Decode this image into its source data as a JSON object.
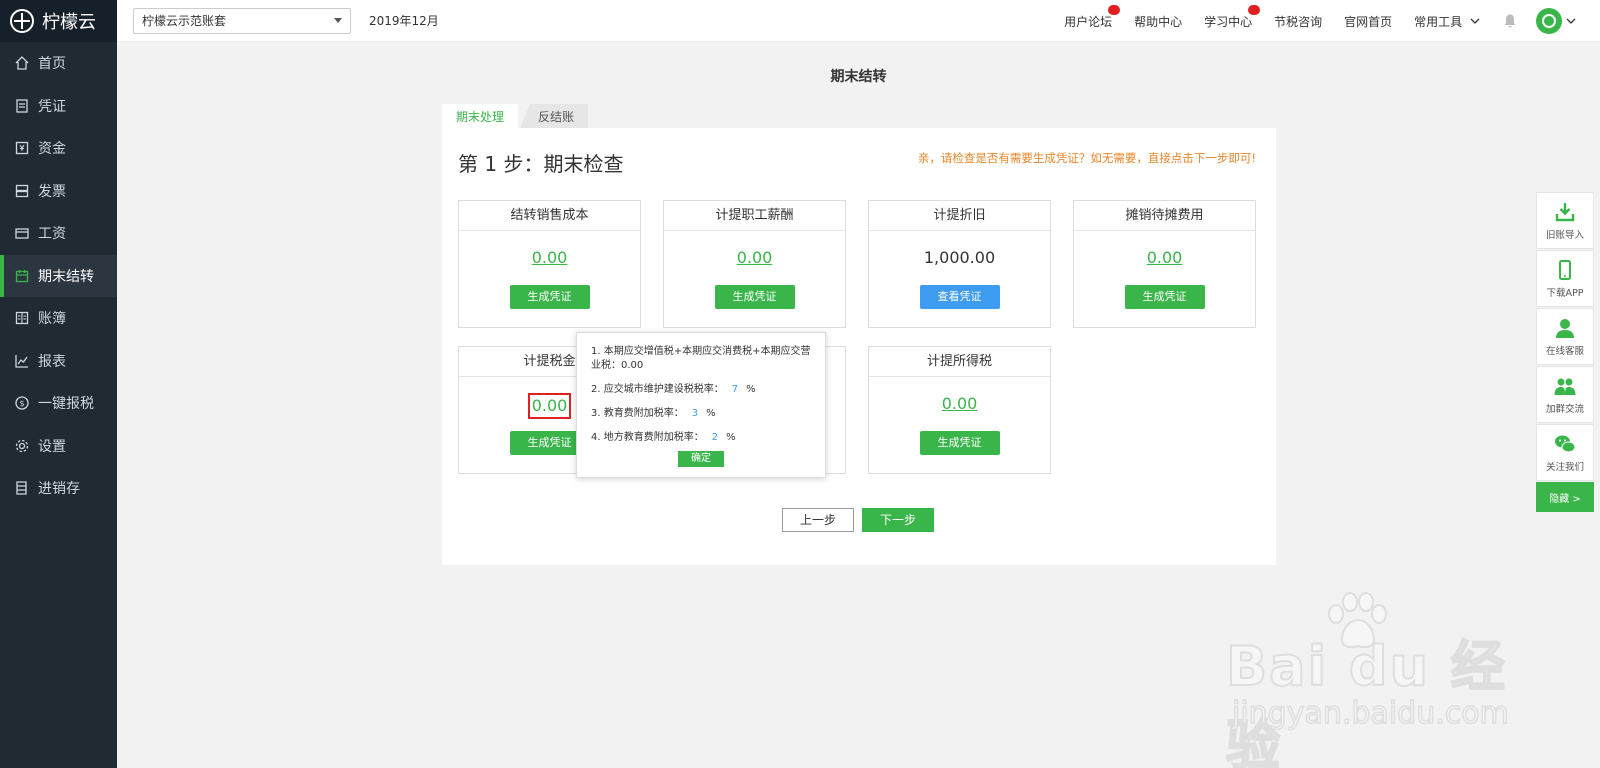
{
  "app": {
    "name": "柠檬云"
  },
  "sidebar": {
    "items": [
      {
        "label": "首页",
        "icon": "home-icon"
      },
      {
        "label": "凭证",
        "icon": "voucher-icon"
      },
      {
        "label": "资金",
        "icon": "fund-icon"
      },
      {
        "label": "发票",
        "icon": "invoice-icon"
      },
      {
        "label": "工资",
        "icon": "salary-icon"
      },
      {
        "label": "期末结转",
        "icon": "calendar-icon",
        "active": true
      },
      {
        "label": "账簿",
        "icon": "ledger-icon"
      },
      {
        "label": "报表",
        "icon": "chart-icon"
      },
      {
        "label": "一键报税",
        "icon": "tax-icon"
      },
      {
        "label": "设置",
        "icon": "gear-icon"
      },
      {
        "label": "进销存",
        "icon": "inventory-icon"
      }
    ]
  },
  "topbar": {
    "account_set": "柠檬云示范账套",
    "period": "2019年12月",
    "links": [
      "用户论坛",
      "帮助中心",
      "学习中心",
      "节税咨询",
      "官网首页",
      "常用工具"
    ]
  },
  "main": {
    "title": "期末结转",
    "tabs": [
      "期末处理",
      "反结账"
    ],
    "step_title": "第 1 步：期末检查",
    "hint": "亲，请检查是否有需要生成凭证？如无需要，直接点击下一步即可!",
    "cards": [
      {
        "title": "结转销售成本",
        "value": "0.00",
        "button": "生成凭证"
      },
      {
        "title": "计提职工薪酬",
        "value": "0.00",
        "button": "生成凭证"
      },
      {
        "title": "计提折旧",
        "value": "1,000.00",
        "button": "查看凭证"
      },
      {
        "title": "摊销待摊费用",
        "value": "0.00",
        "button": "生成凭证"
      },
      {
        "title": "计提税金",
        "value": "0.00",
        "button": "生成凭证"
      },
      {
        "title": "计提所得税",
        "value": "0.00",
        "button": "生成凭证"
      }
    ],
    "prev_label": "上一步",
    "next_label": "下一步"
  },
  "popup": {
    "line1": "1. 本期应交增值税+本期应交消费税+本期应交营业税：0.00",
    "line2_label": "2. 应交城市维护建设税税率：",
    "line2_value": "7",
    "line3_label": "3. 教育费附加税率：",
    "line3_value": "3",
    "line4_label": "4. 地方教育费附加税率：",
    "line4_value": "2",
    "percent": "%",
    "ok_label": "确定"
  },
  "right_float": {
    "items": [
      "旧账导入",
      "下载APP",
      "在线客服",
      "加群交流",
      "关注我们"
    ],
    "hide_label": "隐藏 >"
  },
  "watermark": {
    "text": "Bai du 经验",
    "url": "jingyan.baidu.com"
  },
  "colors": {
    "accent": "#3ab54a",
    "sidebar": "#1f2a33",
    "link_blue": "#3d9bf0",
    "hint_orange": "#e8862a"
  }
}
